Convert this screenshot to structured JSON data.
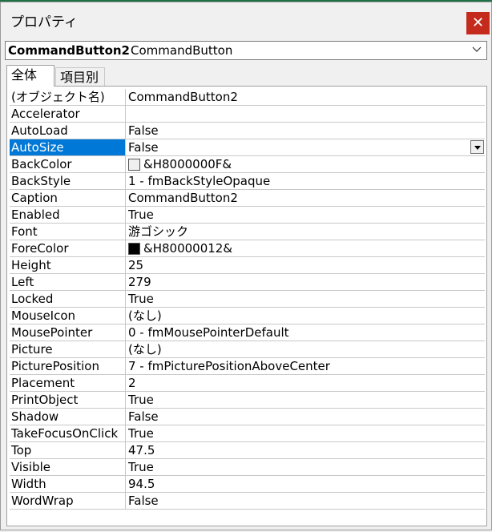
{
  "window": {
    "title": "プロパティ",
    "close_label": "✕"
  },
  "object_selector": {
    "name": "CommandButton2",
    "type": "CommandButton"
  },
  "tabs": [
    {
      "label": "全体",
      "active": true
    },
    {
      "label": "項目別",
      "active": false
    }
  ],
  "properties": [
    {
      "name": "(オブジェクト名)",
      "value": "CommandButton2"
    },
    {
      "name": "Accelerator",
      "value": ""
    },
    {
      "name": "AutoLoad",
      "value": "False"
    },
    {
      "name": "AutoSize",
      "value": "False",
      "selected": true,
      "has_dropdown": true
    },
    {
      "name": "BackColor",
      "value": "&H8000000F&",
      "swatch": "#f0f0f0"
    },
    {
      "name": "BackStyle",
      "value": "1 - fmBackStyleOpaque"
    },
    {
      "name": "Caption",
      "value": "CommandButton2"
    },
    {
      "name": "Enabled",
      "value": "True"
    },
    {
      "name": "Font",
      "value": "游ゴシック"
    },
    {
      "name": "ForeColor",
      "value": "&H80000012&",
      "swatch": "#000000"
    },
    {
      "name": "Height",
      "value": "25"
    },
    {
      "name": "Left",
      "value": "279"
    },
    {
      "name": "Locked",
      "value": "True"
    },
    {
      "name": "MouseIcon",
      "value": "(なし)"
    },
    {
      "name": "MousePointer",
      "value": "0 - fmMousePointerDefault"
    },
    {
      "name": "Picture",
      "value": "(なし)"
    },
    {
      "name": "PicturePosition",
      "value": "7 - fmPicturePositionAboveCenter"
    },
    {
      "name": "Placement",
      "value": "2"
    },
    {
      "name": "PrintObject",
      "value": "True"
    },
    {
      "name": "Shadow",
      "value": "False"
    },
    {
      "name": "TakeFocusOnClick",
      "value": "True"
    },
    {
      "name": "Top",
      "value": "47.5"
    },
    {
      "name": "Visible",
      "value": "True"
    },
    {
      "name": "Width",
      "value": "94.5"
    },
    {
      "name": "WordWrap",
      "value": "False"
    }
  ],
  "colors": {
    "selection": "#0078d7",
    "close_button": "#c42b1c",
    "title_accent": "#1e7145"
  }
}
